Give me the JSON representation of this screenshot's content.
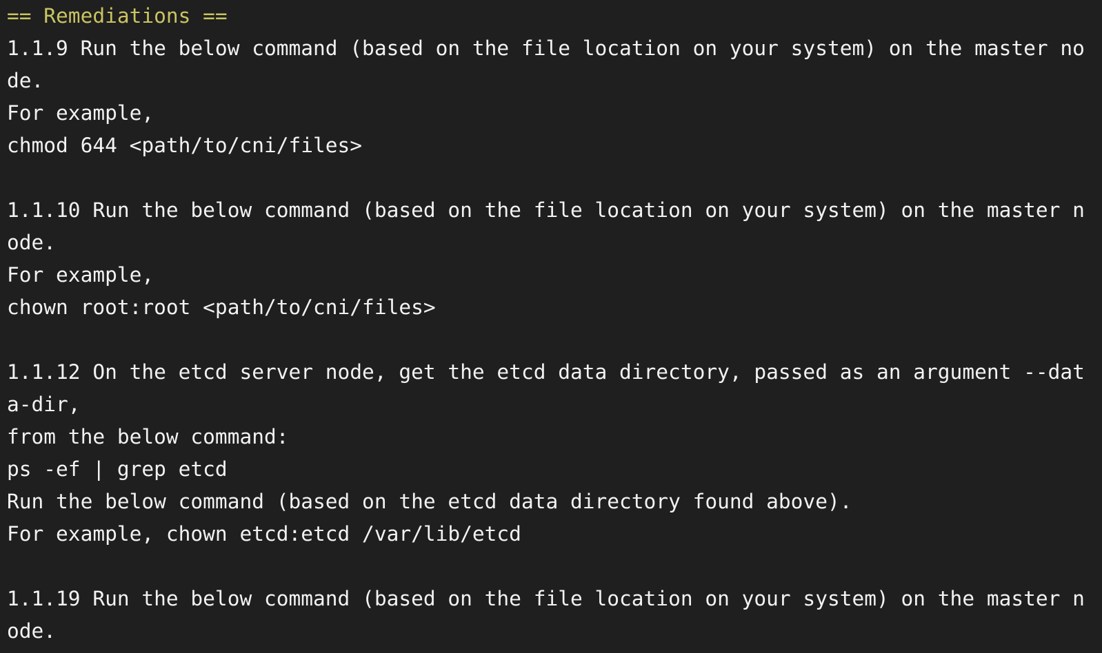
{
  "terminal": {
    "lines": [
      "== Remediations ==",
      "1.1.9 Run the below command (based on the file location on your system) on the master no",
      "de.",
      "For example,",
      "chmod 644 <path/to/cni/files>",
      "",
      "1.1.10 Run the below command (based on the file location on your system) on the master n",
      "ode.",
      "For example,",
      "chown root:root <path/to/cni/files>",
      "",
      "1.1.12 On the etcd server node, get the etcd data directory, passed as an argument --dat",
      "a-dir,",
      "from the below command:",
      "ps -ef | grep etcd",
      "Run the below command (based on the etcd data directory found above).",
      "For example, chown etcd:etcd /var/lib/etcd",
      "",
      "1.1.19 Run the below command (based on the file location on your system) on the master n",
      "ode."
    ],
    "colors": {
      "background": "#1f1f1f",
      "text": "#f2f2f2",
      "header": "#c9c462"
    }
  }
}
